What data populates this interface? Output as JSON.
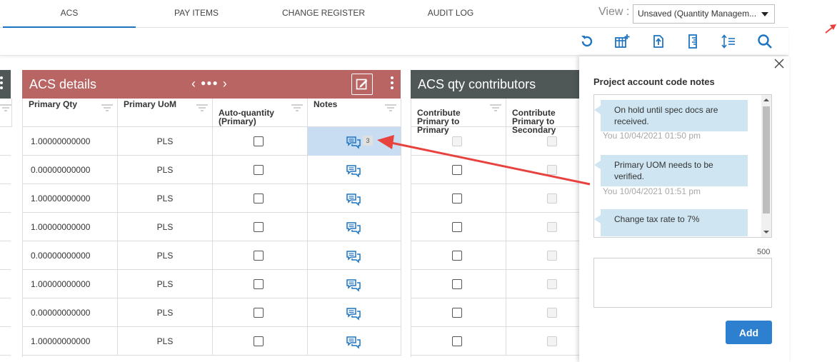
{
  "tabs": [
    {
      "label": "ACS",
      "active": true
    },
    {
      "label": "PAY ITEMS",
      "active": false
    },
    {
      "label": "CHANGE REGISTER",
      "active": false
    },
    {
      "label": "AUDIT LOG",
      "active": false
    }
  ],
  "view": {
    "label": "View :",
    "selected": "Unsaved (Quantity Managem..."
  },
  "toolbar": {
    "icons": [
      "refresh-icon",
      "add-column-icon",
      "export-icon",
      "ruler-icon",
      "sort-rows-icon",
      "search-icon"
    ]
  },
  "acs_details": {
    "title": "ACS details",
    "pager": {
      "prev": "‹",
      "dots": "●●●",
      "next": "›"
    },
    "columns": [
      "Primary Qty",
      "Primary UoM",
      "Auto-quantity\n(Primary)",
      "Notes"
    ],
    "rows": [
      {
        "qty": "1.00000000000",
        "uom": "PLS",
        "notes_count": "3"
      },
      {
        "qty": "0.00000000000",
        "uom": "PLS",
        "notes_count": ""
      },
      {
        "qty": "1.00000000000",
        "uom": "PLS",
        "notes_count": ""
      },
      {
        "qty": "1.00000000000",
        "uom": "PLS",
        "notes_count": ""
      },
      {
        "qty": "0.00000000000",
        "uom": "PLS",
        "notes_count": ""
      },
      {
        "qty": "1.00000000000",
        "uom": "PLS",
        "notes_count": ""
      },
      {
        "qty": "0.00000000000",
        "uom": "PLS",
        "notes_count": ""
      },
      {
        "qty": "1.00000000000",
        "uom": "PLS",
        "notes_count": ""
      }
    ]
  },
  "contributors": {
    "title": "ACS qty contributors",
    "columns": [
      "Contribute\nPrimary to\nPrimary",
      "Contribute\nPrimary to\nSecondary"
    ]
  },
  "notes_panel": {
    "title": "Project account code notes",
    "notes": [
      {
        "text": "On hold until spec docs are received.",
        "stamp": "You 10/04/2021 01:50 pm"
      },
      {
        "text": "Primary UOM needs to be verified.",
        "stamp": "You 10/04/2021 01:51 pm"
      },
      {
        "text": "Change tax rate to 7%",
        "stamp": ""
      }
    ],
    "char_limit": "500",
    "input_value": "",
    "add_label": "Add"
  },
  "colors": {
    "acs_header": "#b86564",
    "contrib_header": "#4f5757",
    "accent": "#1f74c2",
    "annotation_arrow": "#e8423f",
    "note_bubble": "#cfe6f2"
  }
}
